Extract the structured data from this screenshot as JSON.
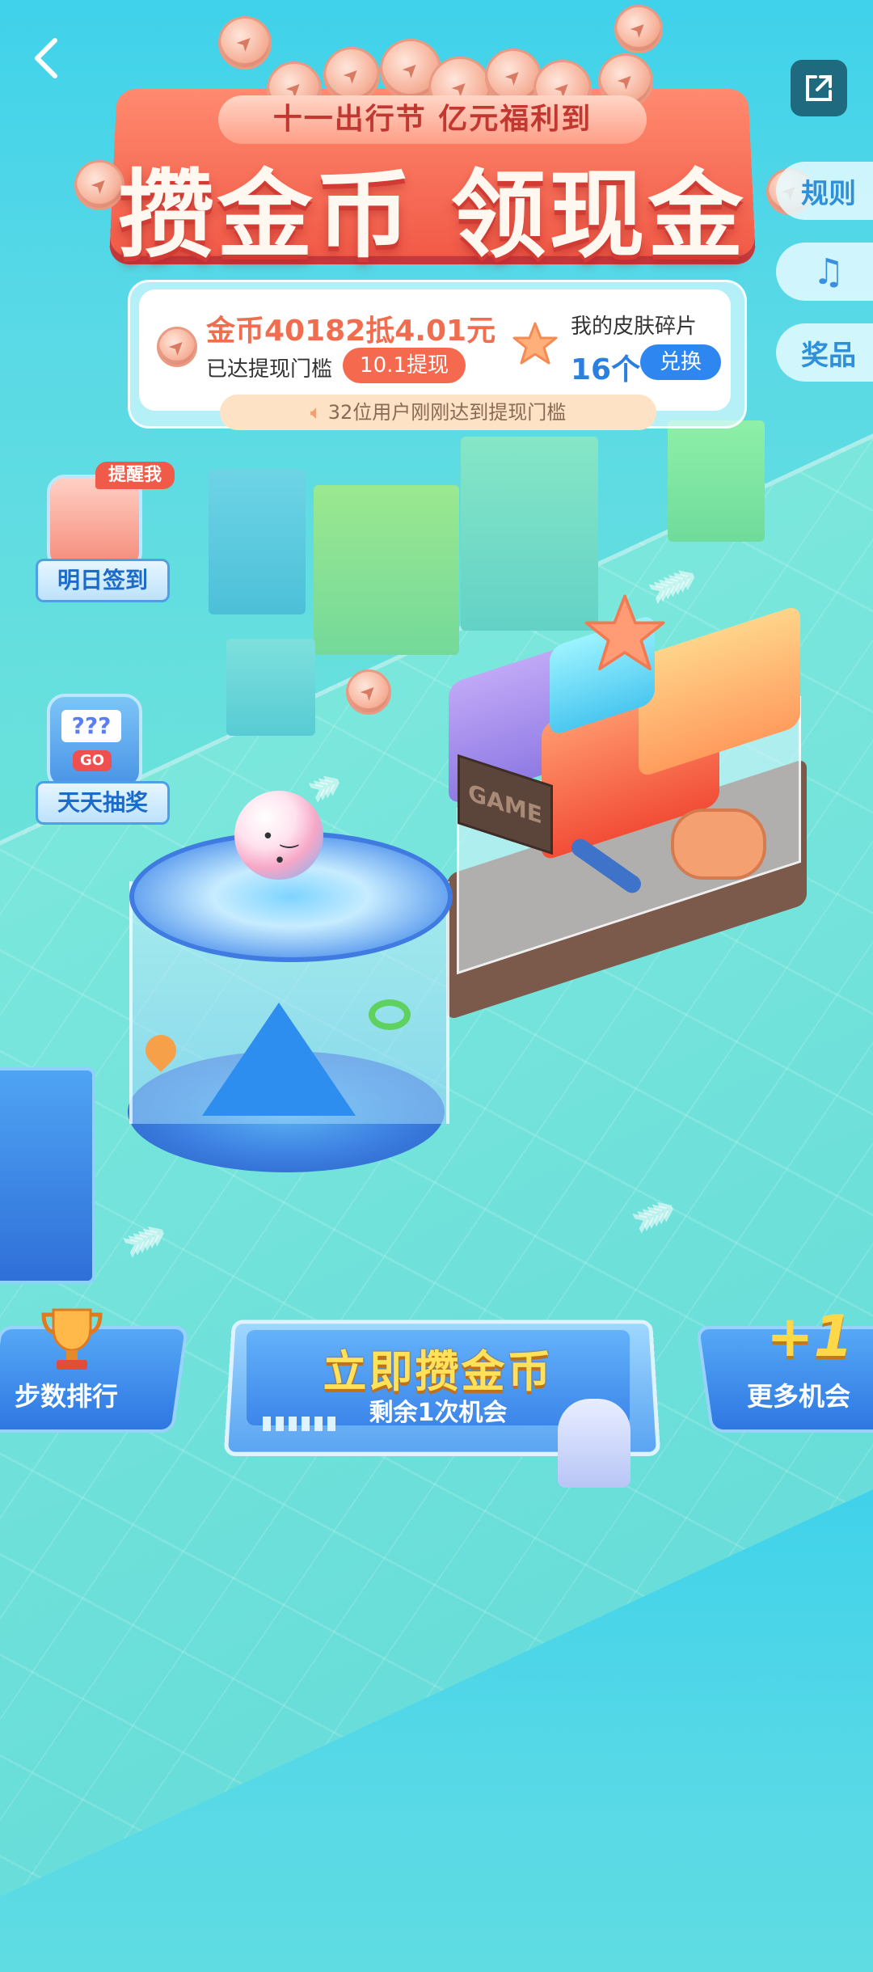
{
  "header": {
    "back_icon": "chevron-left-icon",
    "share_icon": "share-icon"
  },
  "banner": {
    "subtitle": "十一出行节 亿元福利到",
    "title": "攒金币 领现金"
  },
  "side_menu": {
    "rules_label": "规则",
    "music_icon": "music-note-icon",
    "prizes_label": "奖品"
  },
  "info_card": {
    "coin_text": "金币40182抵4.01元",
    "threshold_text": "已达提现门槛",
    "withdraw_label": "10.1提现",
    "skin_label": "我的皮肤碎片",
    "skin_count": "16个",
    "exchange_label": "兑换",
    "notice_text": "32位用户刚刚达到提现门槛"
  },
  "left_entries": {
    "checkin_tag": "提醒我",
    "checkin_label": "明日签到",
    "lottery_label": "天天抽奖",
    "lottery_screen_text": "???",
    "lottery_go": "GO"
  },
  "scene": {
    "game_sign": "GAME"
  },
  "bottom_bar": {
    "rank_label": "步数排行",
    "main_title": "立即攒金币",
    "main_sub": "剩余1次机会",
    "more_plus": "+1",
    "more_label": "更多机会"
  },
  "colors": {
    "accent_red": "#f15a47",
    "accent_blue": "#2e86f0",
    "coin_orange": "#f06e4f",
    "button_gold": "#ffe15a"
  }
}
